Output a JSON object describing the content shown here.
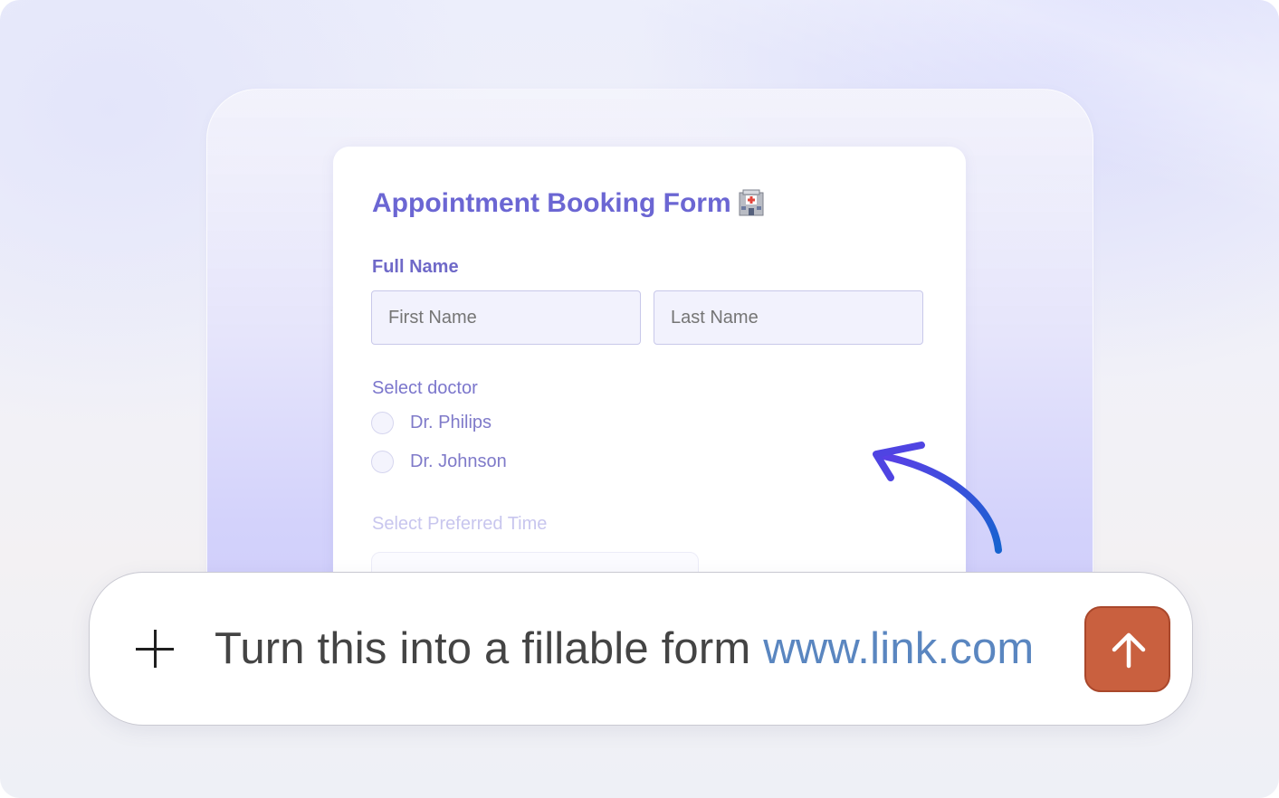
{
  "form": {
    "title": "Appointment Booking Form",
    "title_icon": "hospital-icon",
    "full_name_label": "Full Name",
    "first_name_placeholder": "First Name",
    "last_name_placeholder": "Last Name",
    "select_doctor_label": "Select doctor",
    "doctors": [
      "Dr. Philips",
      "Dr. Johnson"
    ],
    "preferred_time_label": "Select Preferred Time"
  },
  "prompt": {
    "text": "Turn this into a fillable form ",
    "link": "www.link.com",
    "add_icon": "plus-icon",
    "send_icon": "arrow-up-icon"
  },
  "colors": {
    "accent": "#6b66d3",
    "send_button": "#c9603f",
    "link": "#5a86c0",
    "arrow": "#3f46e0"
  }
}
